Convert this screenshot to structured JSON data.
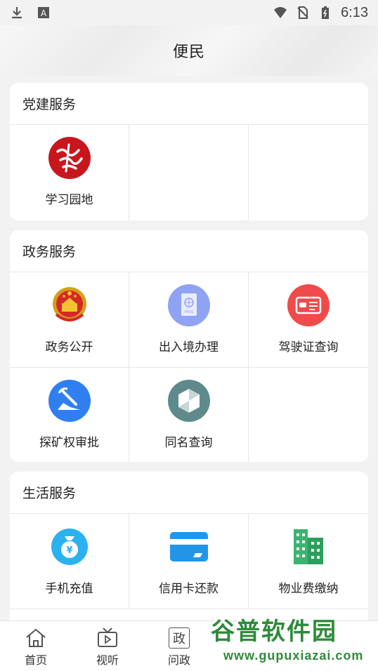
{
  "status_bar": {
    "time": "6:13"
  },
  "header": {
    "title": "便民"
  },
  "sections": [
    {
      "title": "党建服务",
      "items": [
        {
          "label": "学习园地",
          "icon": "xuexi-logo-icon"
        }
      ]
    },
    {
      "title": "政务服务",
      "items": [
        {
          "label": "政务公开",
          "icon": "national-emblem-icon"
        },
        {
          "label": "出入境办理",
          "icon": "passport-icon"
        },
        {
          "label": "驾驶证查询",
          "icon": "driver-license-icon"
        },
        {
          "label": "探矿权审批",
          "icon": "mining-icon"
        },
        {
          "label": "同名查询",
          "icon": "shield-search-icon"
        }
      ]
    },
    {
      "title": "生活服务",
      "items": [
        {
          "label": "手机充值",
          "icon": "money-bag-icon"
        },
        {
          "label": "信用卡还款",
          "icon": "credit-card-icon"
        },
        {
          "label": "物业费缴纳",
          "icon": "buildings-icon"
        }
      ]
    }
  ],
  "tabbar": [
    {
      "label": "首页",
      "icon": "home-icon"
    },
    {
      "label": "视听",
      "icon": "tv-icon"
    },
    {
      "label": "问政",
      "icon": "zheng-icon",
      "icon_text": "政"
    }
  ],
  "watermark": {
    "text": "谷普软件园",
    "url": "www.gupuxiazai.com"
  },
  "colors": {
    "xuexi_red": "#c8161d",
    "passport_blue": "#8fa3f2",
    "license_red": "#ef4b4b",
    "mining_blue": "#2f7ff0",
    "shield_teal": "#5f8a8b",
    "money_blue": "#2ab1f0",
    "card_blue": "#2196e8",
    "building_green": "#3cb371"
  }
}
